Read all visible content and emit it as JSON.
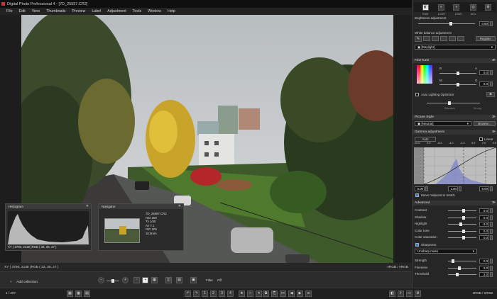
{
  "window": {
    "title": "Digital Photo Professional 4 - [7D_25597.CR2]",
    "controls": [
      "–",
      "□",
      "✕"
    ]
  },
  "menu": [
    "File",
    "Edit",
    "View",
    "Thumbnails",
    "Preview",
    "Label",
    "Adjustment",
    "Tools",
    "Window",
    "Help"
  ],
  "histogram": {
    "title": "Histogram",
    "readout": "XY ( 3790, 2136 )RGB (  33,  36,  27 )"
  },
  "navigator": {
    "title": "Navigator",
    "info": [
      "7D_25597.CR2",
      "ISO 200",
      "Tv 1/40",
      "Av 7.1",
      "ISO 200",
      "10.0mm"
    ]
  },
  "status": {
    "xy": "XY ( 3790, 2136 )RGB (  33,  36,  27 )",
    "color_space": "sRGB / sRGB"
  },
  "collection": {
    "add_label": "Add collection",
    "filter_label": "Filter",
    "filter_value": "Off"
  },
  "bottom": {
    "counter": "1 / 207",
    "color_space": "sRGB / sRGB"
  },
  "right": {
    "tabs_top": [
      "RAW",
      "LIGHT",
      "LENS",
      "ADV"
    ],
    "brightness": {
      "label": "Brightness adjustment",
      "value": "0.50",
      "fraction": 0.58
    },
    "wb": {
      "label": "White balance adjustment",
      "preset": "[Daylight]",
      "register": "Register"
    },
    "finetune": {
      "title": "Fine-tune",
      "B": "B",
      "A": "A",
      "M": "M",
      "G": "G",
      "b_value": "0.0",
      "a_value": "0.0"
    },
    "alo": {
      "label": "Auto Lighting Optimizer",
      "levels": [
        "Standard",
        "Strong"
      ]
    },
    "picstyle": {
      "title": "Picture Style",
      "value": "[Neutral]",
      "browse": "Browse..."
    },
    "gamma": {
      "title": "Gamma adjustment",
      "auto": "Auto",
      "linear": "Linear",
      "scale": [
        "-10.0",
        "0.0",
        "-6.0",
        "-4.0",
        "-2.0",
        "0.0",
        "2.0",
        "4.0"
      ],
      "left_val": "0.00",
      "mid_val": "1.00",
      "right_val": "9.00",
      "checkbox": "Move midpoint to match"
    },
    "advanced": {
      "title": "Advanced",
      "rows": [
        {
          "label": "Contrast",
          "value": "0.0"
        },
        {
          "label": "Shadow",
          "value": "0.0"
        },
        {
          "label": "Highlight",
          "value": "-3.0"
        },
        {
          "label": "Color tone",
          "value": "0.0"
        },
        {
          "label": "Color saturation",
          "value": "0.0"
        }
      ]
    },
    "sharpness": {
      "title": "Sharpness",
      "mode": "Unsharp mask",
      "rows": [
        {
          "label": "Strength",
          "value": "0.0"
        },
        {
          "label": "Fineness",
          "value": "2.0"
        },
        {
          "label": "Threshold",
          "value": "2.0"
        }
      ]
    }
  }
}
